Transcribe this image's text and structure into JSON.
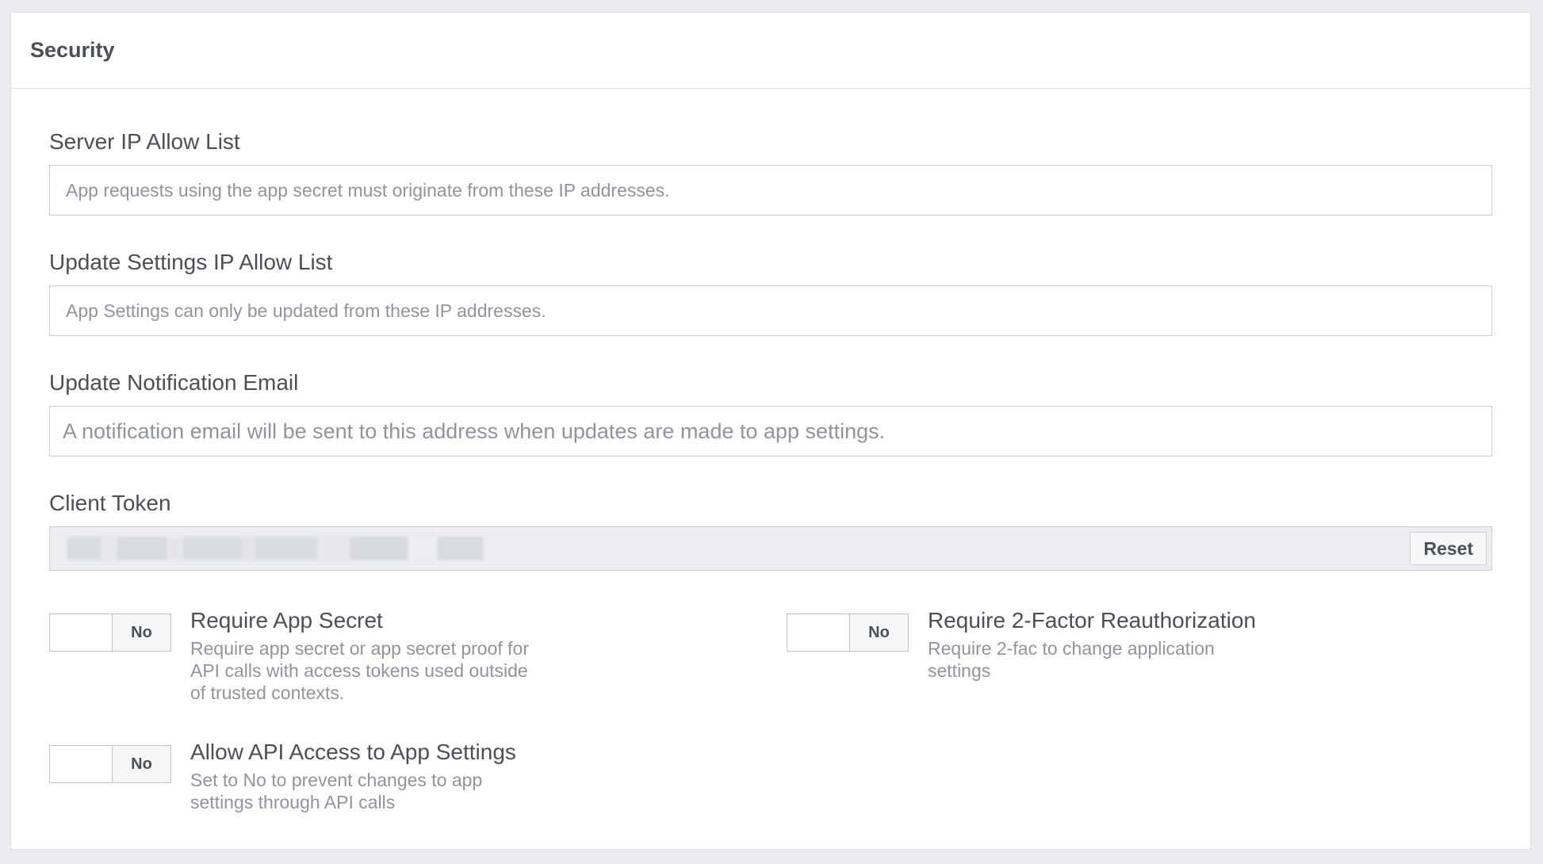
{
  "panel": {
    "title": "Security"
  },
  "fields": [
    {
      "label": "Server IP Allow List",
      "placeholder": "App requests using the app secret must originate from these IP addresses.",
      "value": ""
    },
    {
      "label": "Update Settings IP Allow List",
      "placeholder": "App Settings can only be updated from these IP addresses.",
      "value": ""
    },
    {
      "label": "Update Notification Email",
      "placeholder": "A notification email will be sent to this address when updates are made to app settings.",
      "value": ""
    }
  ],
  "client_token": {
    "label": "Client Token",
    "reset_label": "Reset"
  },
  "toggles": [
    {
      "title": "Require App Secret",
      "state": "No",
      "description_lines": [
        "Require app secret or app secret proof for",
        "API calls with access tokens used outside",
        "of trusted contexts."
      ]
    },
    {
      "title": "Require 2-Factor Reauthorization",
      "state": "No",
      "description_lines": [
        "Require 2-fac to change application",
        "settings"
      ]
    },
    {
      "title": "Allow API Access to App Settings",
      "state": "No",
      "description_lines": [
        "Set to No to prevent changes to app",
        "settings through API calls"
      ]
    }
  ]
}
